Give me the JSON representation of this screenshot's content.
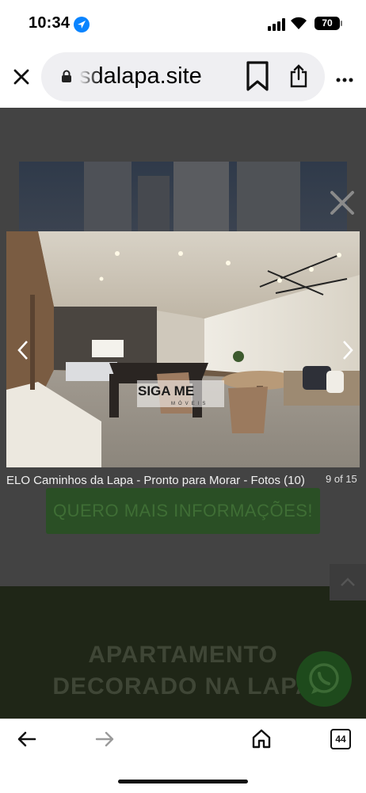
{
  "status_bar": {
    "time": "10:34",
    "battery": "70"
  },
  "browser": {
    "url": "sdalapa.site",
    "tab_count": "44"
  },
  "page": {
    "cta_label": "QUERO MAIS INFORMAÇÕES!",
    "headline_line1": "APARTAMENTO",
    "headline_line2": "DECORADO NA LAPA"
  },
  "lightbox": {
    "caption": "ELO Caminhos da Lapa - Pronto para Morar - Fotos (10)",
    "counter": "9 of 15",
    "watermark_top": "SIGA ME",
    "watermark_bottom": "MÓVEIS"
  },
  "colors": {
    "accent_blue": "#0a84ff",
    "cta_green": "#2a4f25",
    "overlay": "#434343"
  },
  "icons": [
    "close-icon",
    "lock-icon",
    "bookmark-icon",
    "share-icon",
    "more-icon",
    "location-arrow-icon",
    "chevron-left-icon",
    "chevron-right-icon",
    "back-arrow-icon",
    "forward-arrow-icon",
    "home-icon",
    "whatsapp-icon",
    "chevron-up-icon"
  ]
}
